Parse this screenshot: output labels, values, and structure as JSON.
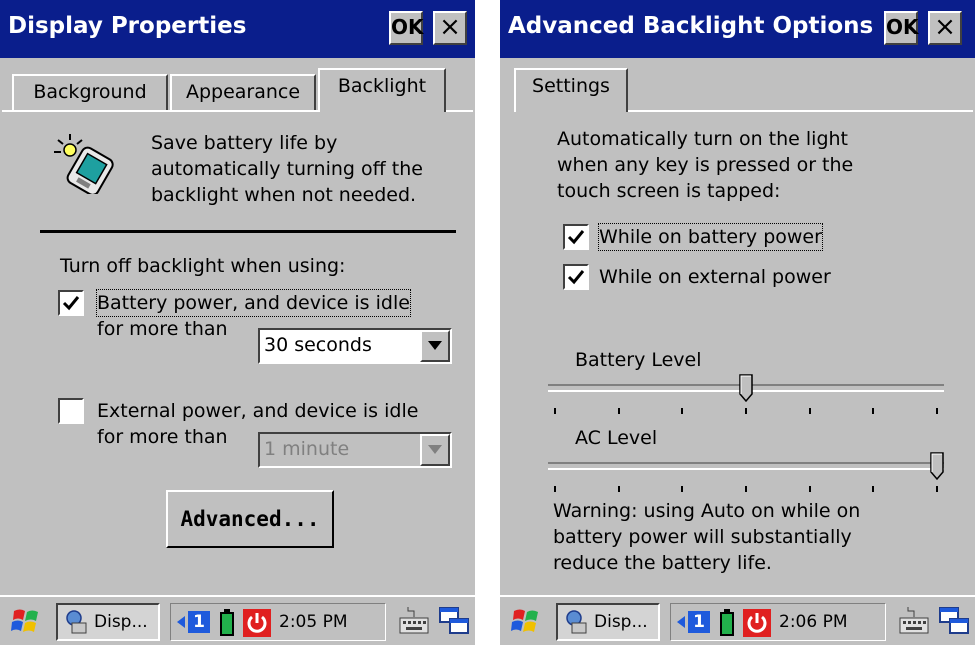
{
  "left": {
    "title": "Display Properties",
    "ok_label": "OK",
    "close_label": "×",
    "tabs": [
      {
        "label": "Background",
        "active": false
      },
      {
        "label": "Appearance",
        "active": false
      },
      {
        "label": "Backlight",
        "active": true
      }
    ],
    "intro_lines": [
      "Save battery life by",
      "automatically turning off the",
      "backlight when not needed."
    ],
    "section_label": "Turn off backlight when using:",
    "battery": {
      "checked": true,
      "line1": "Battery power, and device is idle",
      "line2": "for more than",
      "value": "30 seconds"
    },
    "external": {
      "checked": false,
      "line1": "External power, and device is idle",
      "line2": "for more than",
      "value": "1 minute",
      "disabled": true
    },
    "advanced_label": "Advanced...",
    "taskbar": {
      "app_label": "Disp...",
      "clock": "2:05 PM",
      "tray_number": "1"
    }
  },
  "right": {
    "title": "Advanced Backlight Options",
    "ok_label": "OK",
    "close_label": "×",
    "tabs": [
      {
        "label": "Settings",
        "active": true
      }
    ],
    "intro_lines": [
      "Automatically turn on the light",
      "when any key is pressed or the",
      "touch screen is tapped:"
    ],
    "battery_checkbox": {
      "checked": true,
      "label": "While on battery power"
    },
    "external_checkbox": {
      "checked": true,
      "label": "While on external power"
    },
    "battery_level": {
      "label": "Battery Level",
      "value_fraction": 0.5
    },
    "ac_level": {
      "label": "AC Level",
      "value_fraction": 1.0
    },
    "warning_lines": [
      "Warning: using Auto on while on",
      "battery power will substantially",
      "reduce the battery life."
    ],
    "taskbar": {
      "app_label": "Disp...",
      "clock": "2:06 PM",
      "tray_number": "1"
    }
  },
  "colors": {
    "titlebar": "#0a1e8c",
    "window": "#c0c0c0",
    "battery_green": "#22b14c",
    "power_red": "#e02020"
  },
  "icons": [
    "backlight-device-icon",
    "start-windows-icon",
    "display-app-icon",
    "tray-arrow-icon",
    "battery-icon",
    "power-icon",
    "keyboard-icon",
    "window-switch-icon"
  ]
}
